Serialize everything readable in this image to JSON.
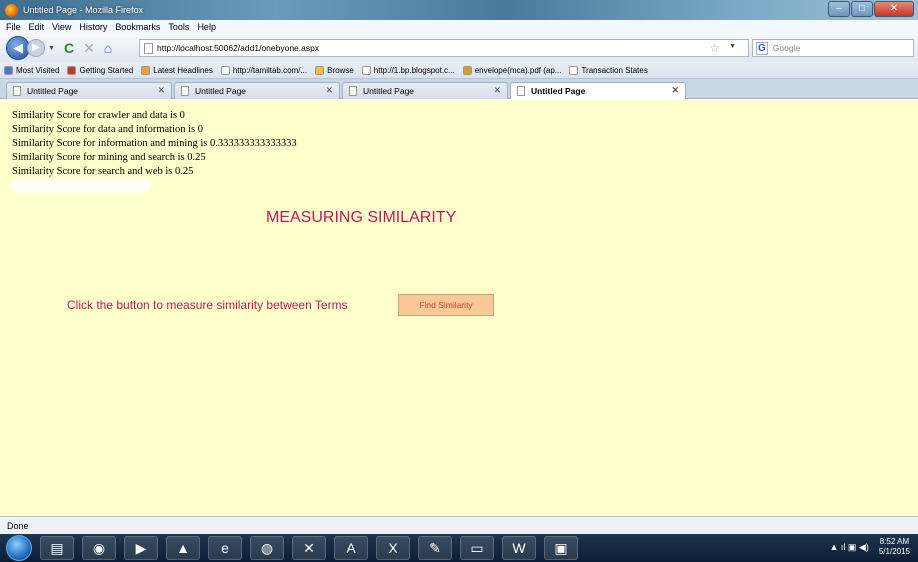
{
  "window": {
    "title": "Untitled Page - Mozilla Firefox"
  },
  "menu": [
    "File",
    "Edit",
    "View",
    "History",
    "Bookmarks",
    "Tools",
    "Help"
  ],
  "nav": {
    "url": "http://localhost:50062/add1/onebyone.aspx",
    "search_placeholder": "Google"
  },
  "bookmarks": [
    {
      "label": "Most Visited",
      "color": "#4a78c8"
    },
    {
      "label": "Getting Started",
      "color": "#c0392b"
    },
    {
      "label": "Latest Headlines",
      "color": "#f0a030"
    },
    {
      "label": "http://tamiltab.com/...",
      "color": "#ffffff"
    },
    {
      "label": "Browse",
      "color": "#f0c040"
    },
    {
      "label": "http://1.bp.blogspot.c...",
      "color": "#ffffff"
    },
    {
      "label": "envelope(mca).pdf (ap...",
      "color": "#d9a020"
    },
    {
      "label": "Transaction States",
      "color": "#ffffff"
    }
  ],
  "tabs": [
    {
      "label": "Untitled Page",
      "active": false
    },
    {
      "label": "Untitled Page",
      "active": false
    },
    {
      "label": "Untitled Page",
      "active": false
    },
    {
      "label": "Untitled Page",
      "active": true
    }
  ],
  "results": [
    "Similarity Score for crawler and data is 0",
    "Similarity Score for data and information is 0",
    "Similarity Score for information and mining is 0.333333333333333",
    "Similarity Score for mining and search is 0.25",
    "Similarity Score for search and web is 0.25"
  ],
  "main": {
    "heading": "MEASURING SIMILARITY",
    "prompt": "Click the button to measure similarity between Terms",
    "button_label": "Find Similarity"
  },
  "status": "Done",
  "taskbar": {
    "apps": [
      "explorer-icon",
      "firefox-icon",
      "media-icon",
      "vlc-icon",
      "ie-icon",
      "chrome-icon",
      "tools-icon",
      "pdf-icon",
      "excel-icon",
      "paint-icon",
      "files-icon",
      "word-icon",
      "access-icon"
    ],
    "time": "8:52 AM",
    "date": "5/1/2015"
  }
}
